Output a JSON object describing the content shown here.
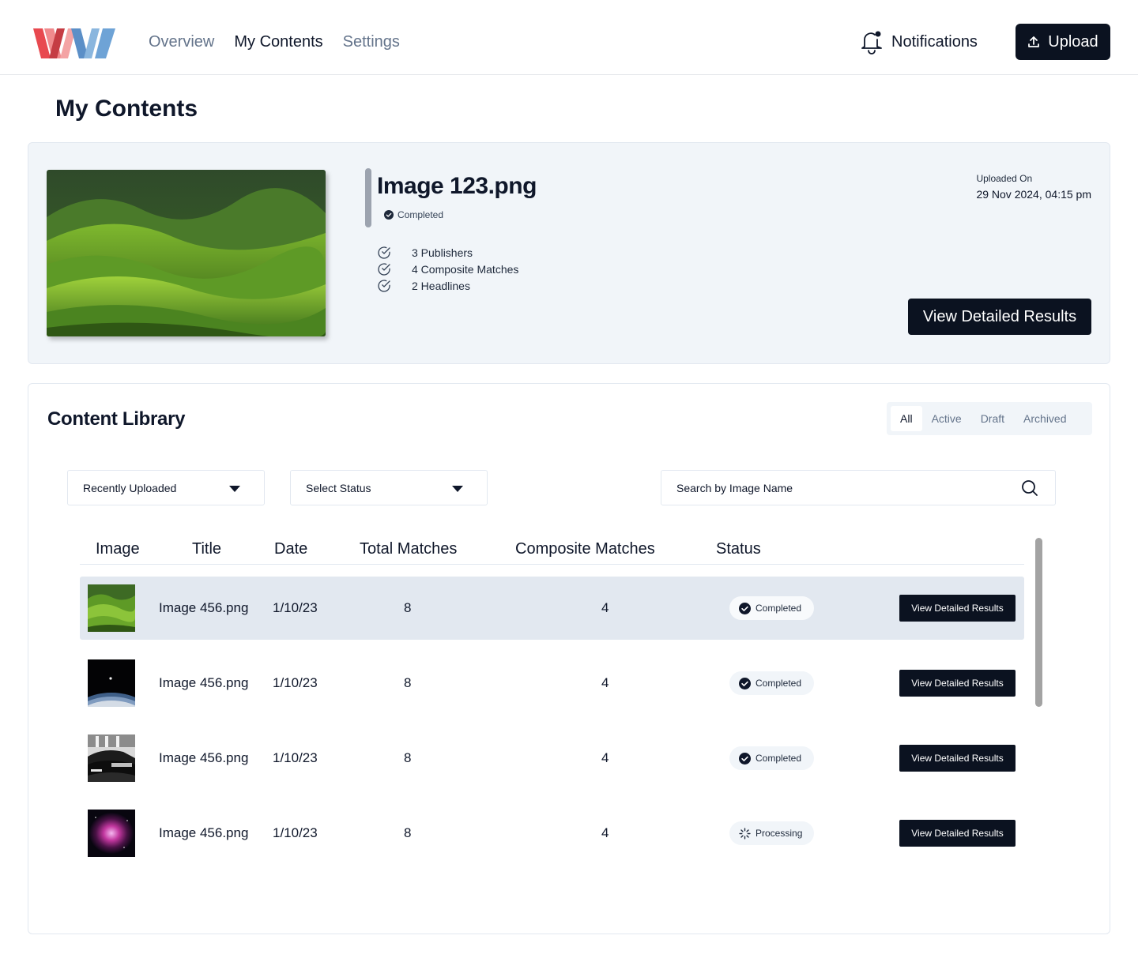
{
  "nav": {
    "items": [
      {
        "label": "Overview",
        "active": false
      },
      {
        "label": "My Contents",
        "active": true
      },
      {
        "label": "Settings",
        "active": false
      }
    ],
    "notifications_label": "Notifications",
    "upload_label": "Upload"
  },
  "page": {
    "title": "My Contents"
  },
  "featured": {
    "title": "Image 123.png",
    "status": "Completed",
    "stats": [
      "3 Publishers",
      "4 Composite Matches",
      "2 Headlines"
    ],
    "uploaded_label": "Uploaded On",
    "uploaded_value": "29 Nov 2024, 04:15 pm",
    "button_label": "View Detailed Results"
  },
  "library": {
    "title": "Content Library",
    "tabs": [
      {
        "label": "All",
        "active": true
      },
      {
        "label": "Active",
        "active": false
      },
      {
        "label": "Draft",
        "active": false
      },
      {
        "label": "Archived",
        "active": false
      }
    ],
    "sort_select": "Recently Uploaded",
    "status_select": "Select Status",
    "search_placeholder": "Search by Image Name",
    "columns": [
      "Image",
      "Title",
      "Date",
      "Total Matches",
      "Composite Matches",
      "Status"
    ],
    "rows": [
      {
        "thumb": "green-hills",
        "title": "Image 456.png",
        "date": "1/10/23",
        "total": "8",
        "composite": "4",
        "status": "Completed",
        "action": "View Detailed Results"
      },
      {
        "thumb": "earth-space",
        "title": "Image 456.png",
        "date": "1/10/23",
        "total": "8",
        "composite": "4",
        "status": "Completed",
        "action": "View Detailed Results"
      },
      {
        "thumb": "cars",
        "title": "Image 456.png",
        "date": "1/10/23",
        "total": "8",
        "composite": "4",
        "status": "Completed",
        "action": "View Detailed Results"
      },
      {
        "thumb": "nebula",
        "title": "Image 456.png",
        "date": "1/10/23",
        "total": "8",
        "composite": "4",
        "status": "Processing",
        "action": "View Detailed Results"
      }
    ]
  },
  "colors": {
    "primary": "#0b1220",
    "muted": "#64748b",
    "card_bg": "#f1f5f9",
    "highlight_row": "#e2e8f0"
  }
}
